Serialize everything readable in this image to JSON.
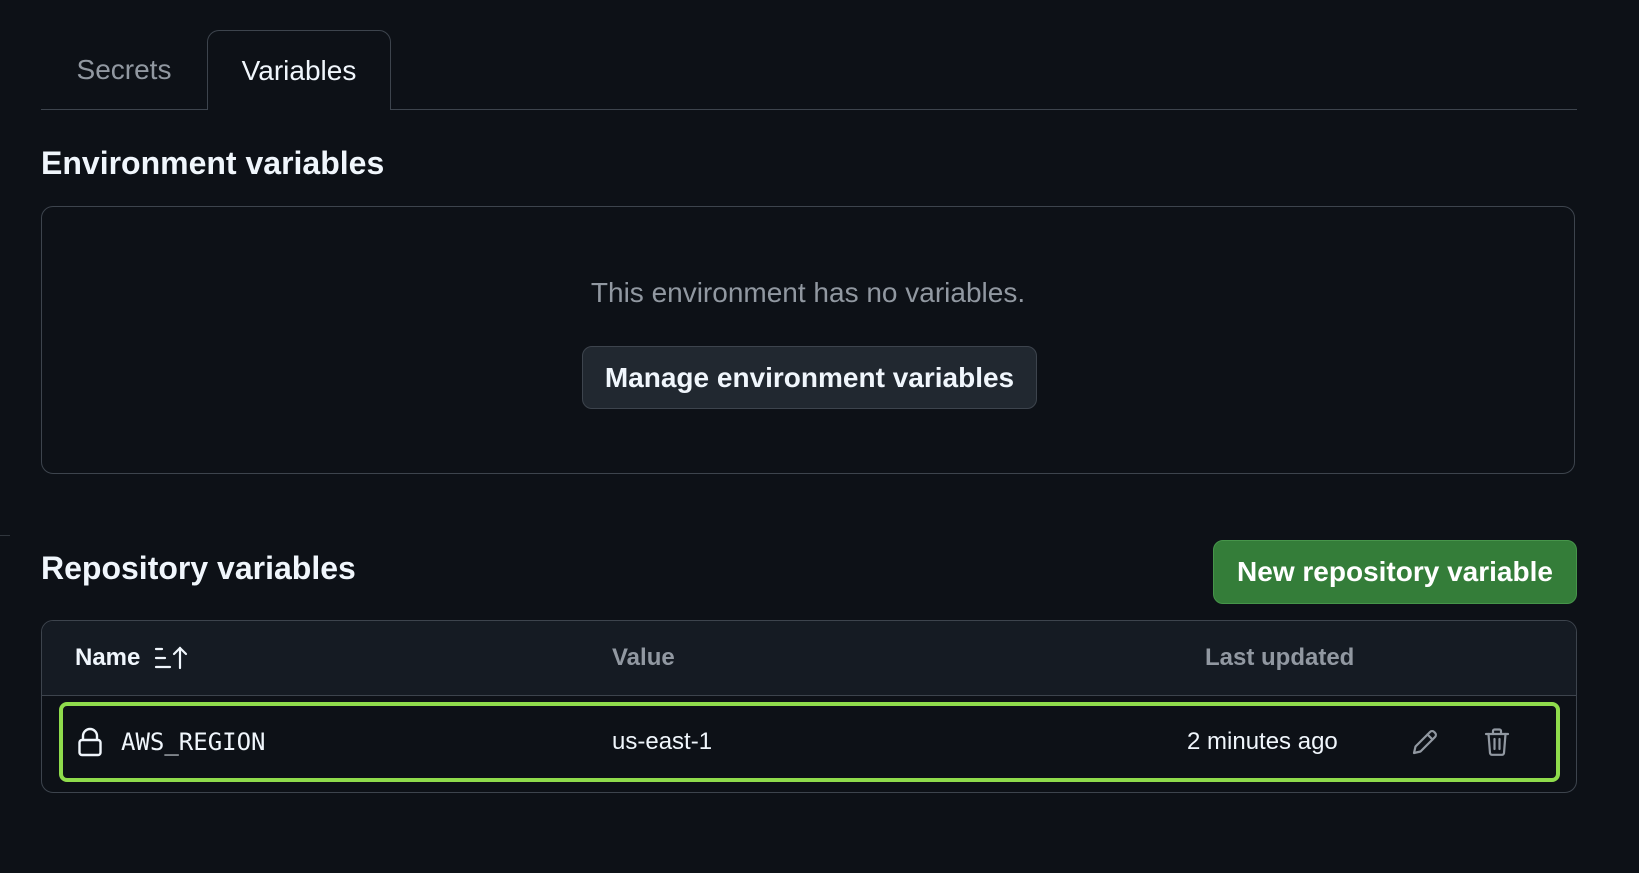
{
  "tabs": [
    {
      "label": "Secrets",
      "selected": false
    },
    {
      "label": "Variables",
      "selected": true
    }
  ],
  "environment": {
    "title": "Environment variables",
    "empty_text": "This environment has no variables.",
    "manage_button": "Manage environment variables"
  },
  "repository": {
    "title": "Repository variables",
    "new_button": "New repository variable",
    "columns": {
      "name": "Name",
      "value": "Value",
      "last_updated": "Last updated"
    },
    "sort_icon": "sort-ascending-icon",
    "rows": [
      {
        "icon": "lock-icon",
        "name": "AWS_REGION",
        "value": "us-east-1",
        "last_updated": "2 minutes ago",
        "actions": [
          "pencil-icon",
          "trash-icon"
        ]
      }
    ]
  },
  "colors": {
    "background": "#0d1117",
    "border": "#3d444d",
    "primary_button": "#347d39",
    "row_highlight": "#8fdc4c",
    "muted_text": "#9198a1"
  }
}
